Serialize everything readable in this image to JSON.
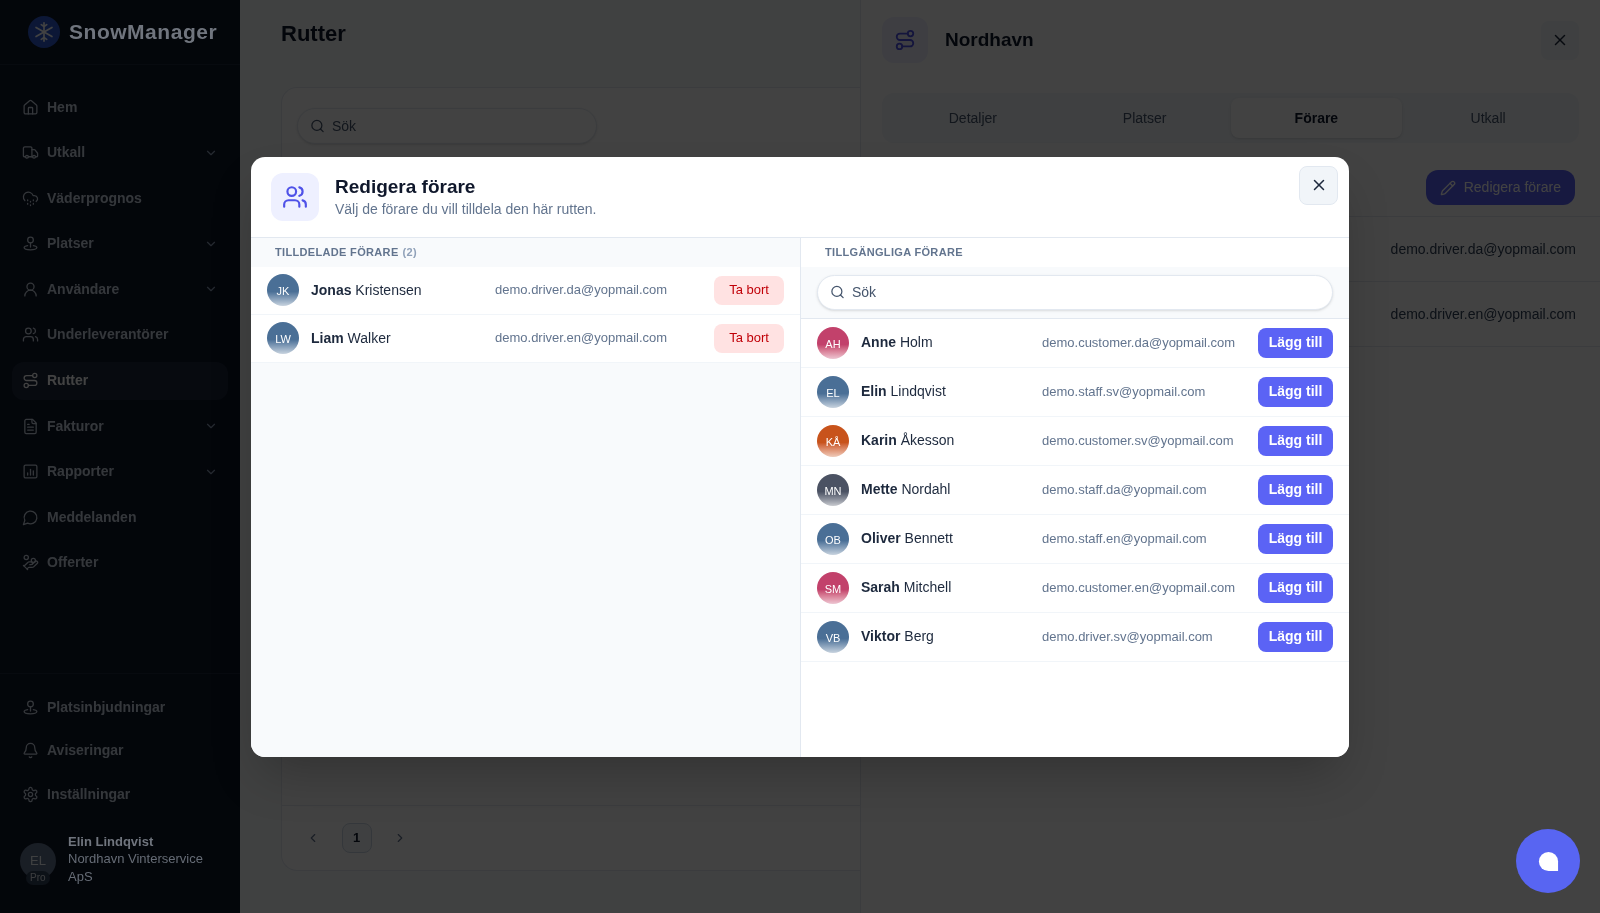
{
  "sidebar": {
    "logo": "SnowManager",
    "nav_items": [
      {
        "label": "Hem",
        "kind": "link",
        "selected": false
      },
      {
        "label": "Utkall",
        "kind": "group",
        "selected": false
      },
      {
        "label": "Väderprognos",
        "kind": "link",
        "selected": false
      },
      {
        "label": "Platser",
        "kind": "group",
        "selected": false
      },
      {
        "label": "Användare",
        "kind": "group",
        "selected": false
      },
      {
        "label": "Underleverantörer",
        "kind": "link",
        "selected": false
      },
      {
        "label": "Rutter",
        "kind": "link",
        "selected": true
      },
      {
        "label": "Fakturor",
        "kind": "group",
        "selected": false
      },
      {
        "label": "Rapporter",
        "kind": "group",
        "selected": false
      },
      {
        "label": "Meddelanden",
        "kind": "link",
        "selected": false
      },
      {
        "label": "Offerter",
        "kind": "link",
        "selected": false
      }
    ],
    "footer_items": [
      {
        "label": "Platsinbjudningar"
      },
      {
        "label": "Aviseringar"
      },
      {
        "label": "Inställningar"
      }
    ],
    "user": {
      "initials": "EL",
      "badge": "Pro",
      "name": "Elin Lindqvist",
      "company": "Nordhavn Vinterservice ApS"
    }
  },
  "main": {
    "title": "Rutter",
    "search": {
      "placeholder": "Sök"
    },
    "pagination": {
      "pages": [
        {
          "label": "1",
          "selected": true
        }
      ]
    }
  },
  "drawer": {
    "title": "Nordhavn",
    "tabs": [
      {
        "label": "Detaljer",
        "selected": false
      },
      {
        "label": "Platser",
        "selected": false
      },
      {
        "label": "Förare",
        "selected": true
      },
      {
        "label": "Utkall",
        "selected": false
      }
    ],
    "edit_button": "Redigera förare",
    "rows": [
      {
        "email": "demo.driver.da@yopmail.com"
      },
      {
        "email": "demo.driver.en@yopmail.com"
      }
    ]
  },
  "modal": {
    "title": "Redigera förare",
    "subtitle": "Välj de förare du vill tilldela den här rutten.",
    "assigned": {
      "heading": "TILLDELADE FÖRARE",
      "count": "(2)",
      "drivers": [
        {
          "initials": "JK",
          "name": "**Jonas** Kristensen",
          "email": "demo.driver.da@yopmail.com",
          "color": "#4a6f96",
          "action": "Ta bort"
        },
        {
          "initials": "LW",
          "name": "**Liam** Walker",
          "email": "demo.driver.en@yopmail.com",
          "color": "#4a6f96",
          "action": "Ta bort"
        }
      ]
    },
    "available": {
      "heading": "TILLGÄNGLIGA FÖRARE",
      "search": {
        "placeholder": "Sök"
      },
      "drivers": [
        {
          "initials": "AH",
          "name": "**Anne** Holm",
          "email": "demo.customer.da@yopmail.com",
          "color": "#c2416b",
          "action": "Lägg till"
        },
        {
          "initials": "EL",
          "name": "**Elin** Lindqvist",
          "email": "demo.staff.sv@yopmail.com",
          "color": "#4a6f96",
          "action": "Lägg till"
        },
        {
          "initials": "KÅ",
          "name": "**Karin** Åkesson",
          "email": "demo.customer.sv@yopmail.com",
          "color": "#c8531b",
          "action": "Lägg till"
        },
        {
          "initials": "MN",
          "name": "**Mette** Nordahl",
          "email": "demo.staff.da@yopmail.com",
          "color": "#4b5263",
          "action": "Lägg till"
        },
        {
          "initials": "OB",
          "name": "**Oliver** Bennett",
          "email": "demo.staff.en@yopmail.com",
          "color": "#4a6f96",
          "action": "Lägg till"
        },
        {
          "initials": "SM",
          "name": "**Sarah** Mitchell",
          "email": "demo.customer.en@yopmail.com",
          "color": "#c2416b",
          "action": "Lägg till"
        },
        {
          "initials": "VB",
          "name": "**Viktor** Berg",
          "email": "demo.driver.sv@yopmail.com",
          "color": "#4a6f96",
          "action": "Lägg till"
        }
      ]
    }
  }
}
